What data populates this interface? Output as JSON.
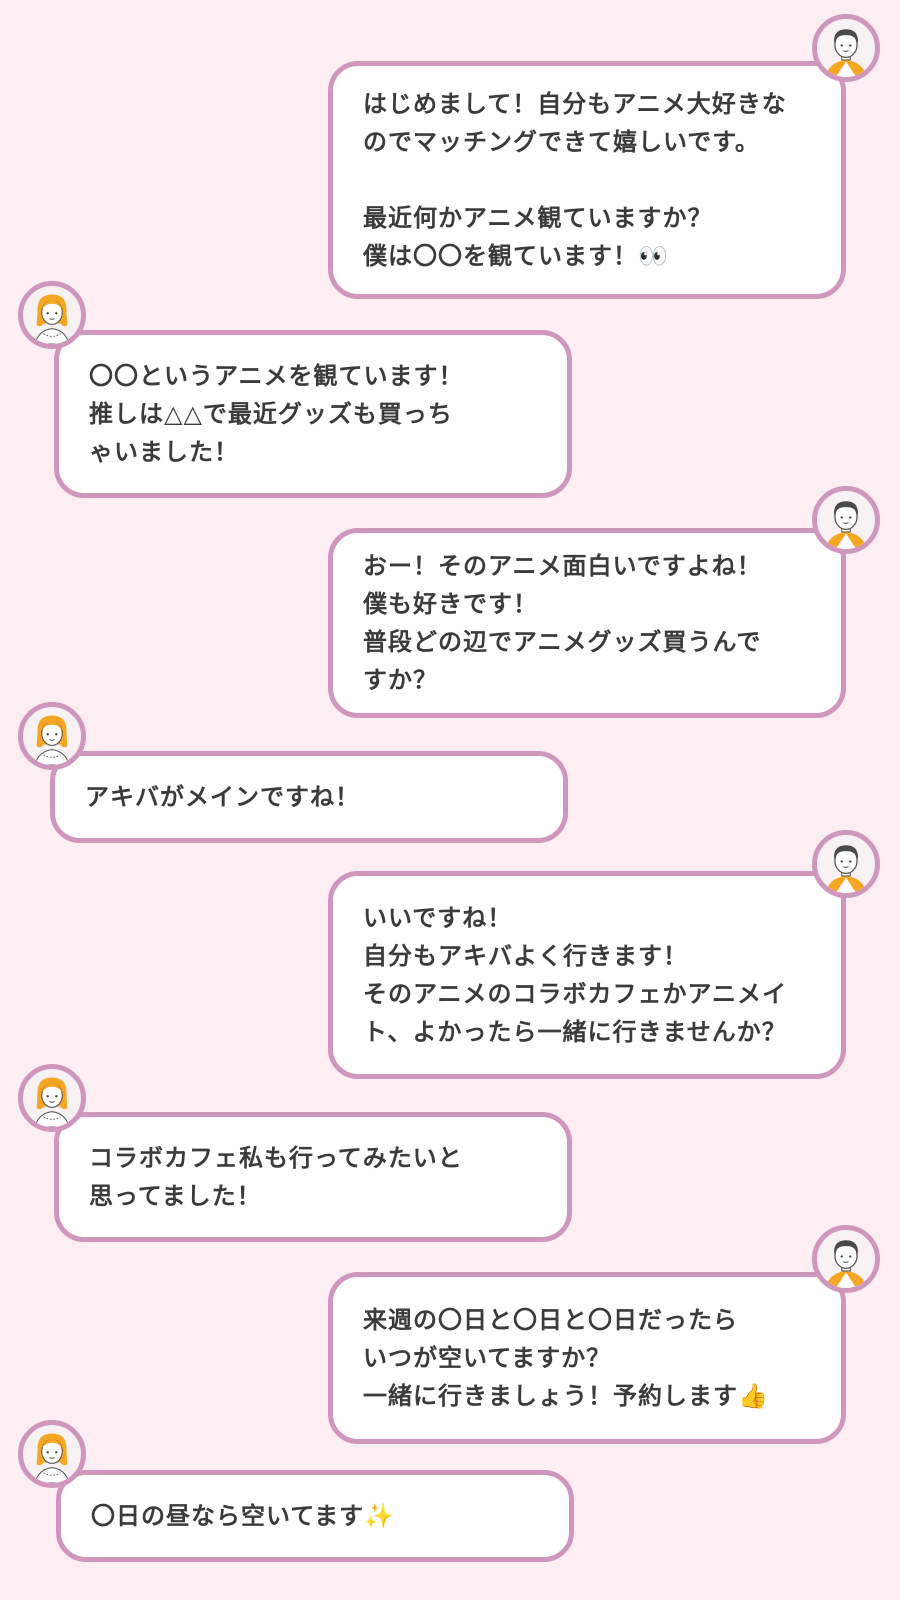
{
  "colors": {
    "background": "#fdeef3",
    "bubble_border": "#cf97bb",
    "bubble_fill": "#ffffff",
    "text": "#3b3b3b",
    "female_hair": "#f5a623",
    "male_hair": "#4a4a4a"
  },
  "messages": [
    {
      "sender": "male",
      "avatar_icon": "male-avatar-icon",
      "text": "はじめまして！自分もアニメ大好きな\nのでマッチングできて嬉しいです。\n\n最近何かアニメ観ていますか？\n僕は〇〇を観ています！👀"
    },
    {
      "sender": "female",
      "avatar_icon": "female-avatar-icon",
      "text": "〇〇というアニメを観ています！\n推しは△△で最近グッズも買っち\nゃいました！"
    },
    {
      "sender": "male",
      "avatar_icon": "male-avatar-icon",
      "text": "おー！そのアニメ面白いですよね！\n僕も好きです！\n普段どの辺でアニメグッズ買うんで\nすか？"
    },
    {
      "sender": "female",
      "avatar_icon": "female-avatar-icon",
      "text": "アキバがメインですね！"
    },
    {
      "sender": "male",
      "avatar_icon": "male-avatar-icon",
      "text": "いいですね！\n自分もアキバよく行きます！\nそのアニメのコラボカフェかアニメイ\nト、よかったら一緒に行きませんか？"
    },
    {
      "sender": "female",
      "avatar_icon": "female-avatar-icon",
      "text": "コラボカフェ私も行ってみたいと\n思ってました！"
    },
    {
      "sender": "male",
      "avatar_icon": "male-avatar-icon",
      "text": "来週の〇日と〇日と〇日だったら\nいつが空いてますか？\n一緒に行きましょう！予約します👍"
    },
    {
      "sender": "female",
      "avatar_icon": "female-avatar-icon",
      "text": "〇日の昼なら空いてます✨"
    }
  ]
}
